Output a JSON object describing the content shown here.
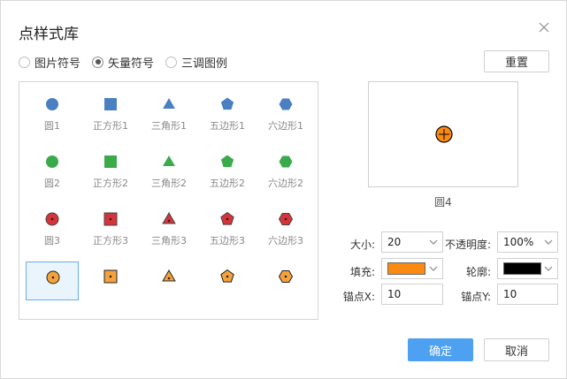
{
  "dialog": {
    "title": "点样式库",
    "close_icon": "close-icon"
  },
  "radios": [
    {
      "label": "图片符号",
      "selected": false
    },
    {
      "label": "矢量符号",
      "selected": true
    },
    {
      "label": "三调图例",
      "selected": false
    }
  ],
  "reset_label": "重置",
  "colors": {
    "blue": "#4a7fc1",
    "green": "#3aaa4a",
    "red": "#d6343a",
    "orange": "#f5a23a",
    "accent": "#4da1f0",
    "fill_orange": "#fb8a12",
    "black": "#000000"
  },
  "symbol_rows": [
    {
      "color": "blue",
      "marked": false,
      "labels": [
        "圆1",
        "正方形1",
        "三角形1",
        "五边形1",
        "六边形1"
      ]
    },
    {
      "color": "green",
      "marked": false,
      "labels": [
        "圆2",
        "正方形2",
        "三角形2",
        "五边形2",
        "六边形2"
      ]
    },
    {
      "color": "red",
      "marked": true,
      "labels": [
        "圆3",
        "正方形3",
        "三角形3",
        "五边形3",
        "六边形3"
      ]
    },
    {
      "color": "orange",
      "marked": true,
      "labels": []
    }
  ],
  "selected_symbol": "圆4",
  "view_toggles": [
    "small-grid-icon",
    "large-grid-icon"
  ],
  "props": {
    "size_label": "大小:",
    "size_value": "20",
    "opacity_label": "不透明度:",
    "opacity_value": "100%",
    "fill_label": "填充:",
    "fill_color": "#fb8a12",
    "outline_label": "轮廓:",
    "outline_color": "#000000",
    "anchor_x_label": "锚点X:",
    "anchor_x_value": "10",
    "anchor_y_label": "锚点Y:",
    "anchor_y_value": "10"
  },
  "buttons": {
    "ok": "确定",
    "cancel": "取消"
  }
}
